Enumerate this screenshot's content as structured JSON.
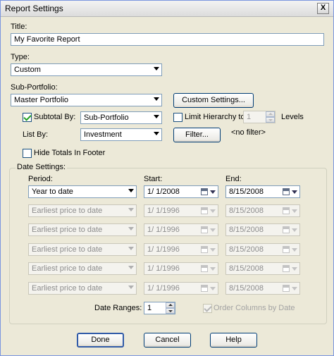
{
  "window": {
    "title": "Report Settings",
    "close_glyph": "X"
  },
  "title_field": {
    "label": "Title:",
    "value": "My Favorite Report"
  },
  "type_field": {
    "label": "Type:",
    "value": "Custom"
  },
  "subportfolio": {
    "label": "Sub-Portfolio:",
    "value": "Master Portfolio",
    "custom_settings_label": "Custom Settings..."
  },
  "subtotal": {
    "label": "Subtotal By:",
    "checked": true,
    "value": "Sub-Portfolio"
  },
  "limit_hierarchy": {
    "label": "Limit Hierarchy to",
    "checked": false,
    "value": "1",
    "suffix": "Levels"
  },
  "list_by": {
    "label": "List By:",
    "value": "Investment",
    "filter_label": "Filter...",
    "filter_status": "<no filter>"
  },
  "hide_totals": {
    "label": "Hide Totals In Footer",
    "checked": false
  },
  "date_settings": {
    "caption": "Date Settings:",
    "period_header": "Period:",
    "start_header": "Start:",
    "end_header": "End:",
    "rows": [
      {
        "period": "Year to date",
        "start": "1/  1/2008",
        "end": "8/15/2008",
        "enabled": true
      },
      {
        "period": "Earliest price to date",
        "start": "1/  1/1996",
        "end": "8/15/2008",
        "enabled": false
      },
      {
        "period": "Earliest price to date",
        "start": "1/  1/1996",
        "end": "8/15/2008",
        "enabled": false
      },
      {
        "period": "Earliest price to date",
        "start": "1/  1/1996",
        "end": "8/15/2008",
        "enabled": false
      },
      {
        "period": "Earliest price to date",
        "start": "1/  1/1996",
        "end": "8/15/2008",
        "enabled": false
      },
      {
        "period": "Earliest price to date",
        "start": "1/  1/1996",
        "end": "8/15/2008",
        "enabled": false
      }
    ],
    "date_ranges_label": "Date Ranges:",
    "date_ranges_value": "1",
    "order_columns_label": "Order Columns by Date",
    "order_columns_checked": true
  },
  "buttons": {
    "done": "Done",
    "cancel": "Cancel",
    "help": "Help"
  }
}
